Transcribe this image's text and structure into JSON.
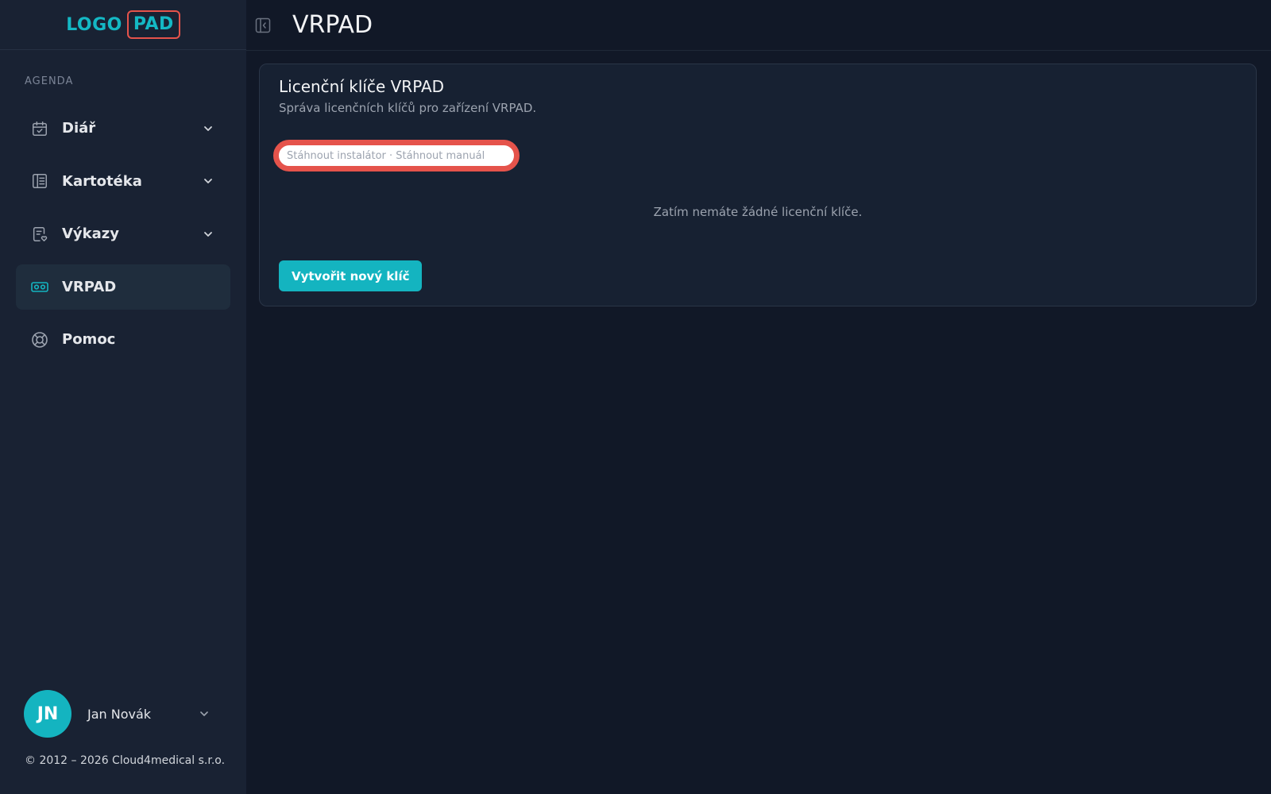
{
  "logo": {
    "part1": "LOGO",
    "part2": "PAD"
  },
  "sidebar": {
    "section_label": "AGENDA",
    "items": [
      {
        "label": "Diář",
        "icon": "calendar-check-icon",
        "has_chevron": true
      },
      {
        "label": "Kartotéka",
        "icon": "file-list-icon",
        "has_chevron": true
      },
      {
        "label": "Výkazy",
        "icon": "report-heart-icon",
        "has_chevron": true
      },
      {
        "label": "VRPAD",
        "icon": "vr-headset-icon",
        "active": true
      },
      {
        "label": "Pomoc",
        "icon": "lifebuoy-icon"
      }
    ]
  },
  "user": {
    "initials": "JN",
    "name": "Jan Novák"
  },
  "footer": {
    "copyright": "© 2012 – 2026 Cloud4medical s.r.o."
  },
  "header": {
    "title": "VRPAD"
  },
  "card": {
    "title": "Licenční klíče VRPAD",
    "subtitle": "Správa licenčních klíčů pro zařízení VRPAD.",
    "links_text": "Stáhnout instalátor · Stáhnout manuál",
    "empty_message": "Zatím nemáte žádné licenční klíče.",
    "create_button": "Vytvořit nový klíč"
  },
  "colors": {
    "accent": "#14b4c0",
    "highlight_red": "#e5534b",
    "sidebar_bg": "#192233",
    "main_bg": "#111827",
    "card_bg": "#172132"
  }
}
